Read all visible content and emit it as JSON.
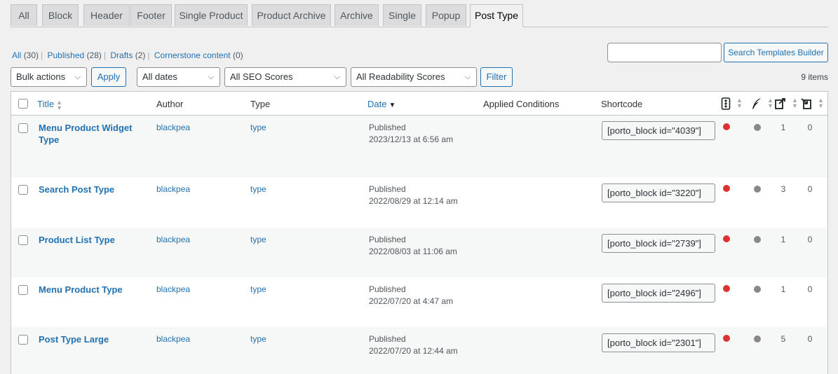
{
  "tabs": [
    "All",
    "Block",
    "Header",
    "Footer",
    "Single Product",
    "Product Archive",
    "Archive",
    "Single",
    "Popup",
    "Post Type"
  ],
  "active_tab": "Post Type",
  "views": [
    {
      "label": "All",
      "count": "(30)"
    },
    {
      "label": "Published",
      "count": "(28)"
    },
    {
      "label": "Drafts",
      "count": "(2)"
    },
    {
      "label": "Cornerstone content",
      "count": "(0)"
    }
  ],
  "search": {
    "button": "Search Templates Builder",
    "value": ""
  },
  "filters": {
    "bulk": "Bulk actions",
    "apply": "Apply",
    "dates": "All dates",
    "seo": "All SEO Scores",
    "readability": "All Readability Scores",
    "filter": "Filter"
  },
  "items_count": "9 items",
  "columns": {
    "title": "Title",
    "author": "Author",
    "type": "Type",
    "date": "Date",
    "conditions": "Applied Conditions",
    "shortcode": "Shortcode",
    "seo_icon": "traffic-light-icon",
    "read_icon": "quill-icon",
    "links_icon": "outgoing-links-icon",
    "inlinks_icon": "incoming-links-icon"
  },
  "rows": [
    {
      "title": "Menu Product Widget Type",
      "author": "blackpea",
      "type": "type",
      "status": "Published",
      "date": "2023/12/13 at 6:56 am",
      "shortcode": "[porto_block id=\"4039\"]",
      "links": "1",
      "inlinks": "0",
      "seo_color": "#dc3232",
      "read_color": "#888888"
    },
    {
      "title": "Search Post Type",
      "author": "blackpea",
      "type": "type",
      "status": "Published",
      "date": "2022/08/29 at 12:14 am",
      "shortcode": "[porto_block id=\"3220\"]",
      "links": "3",
      "inlinks": "0",
      "seo_color": "#dc3232",
      "read_color": "#888888"
    },
    {
      "title": "Product List Type",
      "author": "blackpea",
      "type": "type",
      "status": "Published",
      "date": "2022/08/03 at 11:06 am",
      "shortcode": "[porto_block id=\"2739\"]",
      "links": "1",
      "inlinks": "0",
      "seo_color": "#dc3232",
      "read_color": "#888888"
    },
    {
      "title": "Menu Product Type",
      "author": "blackpea",
      "type": "type",
      "status": "Published",
      "date": "2022/07/20 at 4:47 am",
      "shortcode": "[porto_block id=\"2496\"]",
      "links": "1",
      "inlinks": "0",
      "seo_color": "#dc3232",
      "read_color": "#888888"
    },
    {
      "title": "Post Type Large",
      "author": "blackpea",
      "type": "type",
      "status": "Published",
      "date": "2022/07/20 at 12:44 am",
      "shortcode": "[porto_block id=\"2301\"]",
      "links": "5",
      "inlinks": "0",
      "seo_color": "#dc3232",
      "read_color": "#888888"
    }
  ]
}
